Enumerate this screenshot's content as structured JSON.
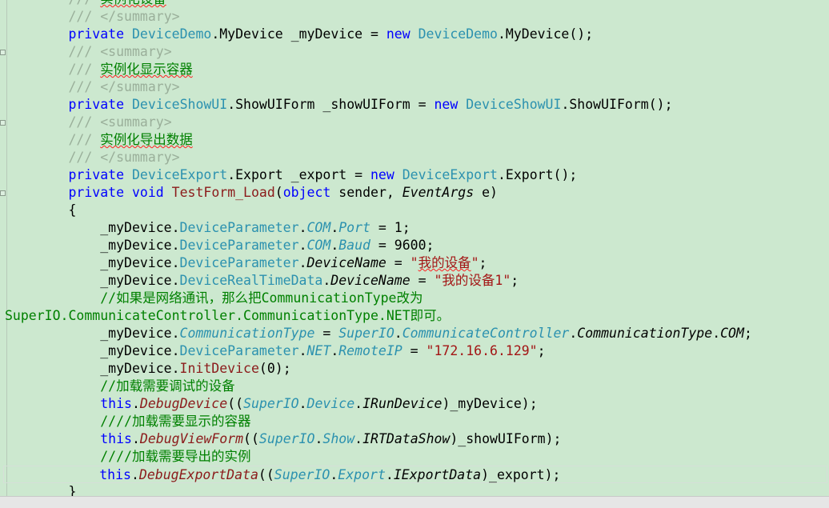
{
  "editor": {
    "lines": [
      {
        "parts": [
          {
            "t": "        "
          },
          {
            "t": "/// ",
            "c": "cg"
          },
          {
            "t": "实例化设备",
            "c": "cm sq cjk"
          }
        ]
      },
      {
        "parts": [
          {
            "t": "        "
          },
          {
            "t": "/// </summary>",
            "c": "cg"
          }
        ]
      },
      {
        "parts": [
          {
            "t": "        "
          },
          {
            "t": "private",
            "c": "kw"
          },
          {
            "t": " "
          },
          {
            "t": "DeviceDemo",
            "c": "ty"
          },
          {
            "t": ".MyDevice _myDevice = "
          },
          {
            "t": "new",
            "c": "kw"
          },
          {
            "t": " "
          },
          {
            "t": "DeviceDemo",
            "c": "ty"
          },
          {
            "t": ".MyDevice();"
          }
        ]
      },
      {
        "parts": [
          {
            "t": "        "
          },
          {
            "t": "/// <summary>",
            "c": "cg"
          }
        ]
      },
      {
        "parts": [
          {
            "t": "        "
          },
          {
            "t": "/// ",
            "c": "cg"
          },
          {
            "t": "实例化显示容器",
            "c": "cm sq cjk"
          }
        ]
      },
      {
        "parts": [
          {
            "t": "        "
          },
          {
            "t": "/// </summary>",
            "c": "cg"
          }
        ]
      },
      {
        "parts": [
          {
            "t": "        "
          },
          {
            "t": "private",
            "c": "kw"
          },
          {
            "t": " "
          },
          {
            "t": "DeviceShowUI",
            "c": "ty"
          },
          {
            "t": ".ShowUIForm _showUIForm = "
          },
          {
            "t": "new",
            "c": "kw"
          },
          {
            "t": " "
          },
          {
            "t": "DeviceShowUI",
            "c": "ty"
          },
          {
            "t": ".ShowUIForm();"
          }
        ]
      },
      {
        "parts": [
          {
            "t": "        "
          },
          {
            "t": "/// <summary>",
            "c": "cg"
          }
        ]
      },
      {
        "parts": [
          {
            "t": "        "
          },
          {
            "t": "/// ",
            "c": "cg"
          },
          {
            "t": "实例化导出数据",
            "c": "cm sq cjk"
          }
        ]
      },
      {
        "parts": [
          {
            "t": "        "
          },
          {
            "t": "/// </summary>",
            "c": "cg"
          }
        ]
      },
      {
        "parts": [
          {
            "t": "        "
          },
          {
            "t": "private",
            "c": "kw"
          },
          {
            "t": " "
          },
          {
            "t": "DeviceExport",
            "c": "ty"
          },
          {
            "t": ".Export _export = "
          },
          {
            "t": "new",
            "c": "kw"
          },
          {
            "t": " "
          },
          {
            "t": "DeviceExport",
            "c": "ty"
          },
          {
            "t": ".Export();"
          }
        ]
      },
      {
        "parts": [
          {
            "t": "        "
          },
          {
            "t": "private",
            "c": "kw"
          },
          {
            "t": " "
          },
          {
            "t": "void",
            "c": "kw"
          },
          {
            "t": " "
          },
          {
            "t": "TestForm_Load",
            "c": "fn"
          },
          {
            "t": "("
          },
          {
            "t": "object",
            "c": "kw"
          },
          {
            "t": " sender, "
          },
          {
            "t": "EventArgs",
            "c": "it"
          },
          {
            "t": " e)"
          }
        ]
      },
      {
        "parts": [
          {
            "t": "        {"
          }
        ]
      },
      {
        "parts": [
          {
            "t": "            _myDevice."
          },
          {
            "t": "DeviceParameter",
            "c": "ty"
          },
          {
            "t": "."
          },
          {
            "t": "COM",
            "c": "ti"
          },
          {
            "t": "."
          },
          {
            "t": "Port",
            "c": "ti"
          },
          {
            "t": " = 1;"
          }
        ]
      },
      {
        "parts": [
          {
            "t": "            _myDevice."
          },
          {
            "t": "DeviceParameter",
            "c": "ty"
          },
          {
            "t": "."
          },
          {
            "t": "COM",
            "c": "ti"
          },
          {
            "t": "."
          },
          {
            "t": "Baud",
            "c": "ti"
          },
          {
            "t": " = 9600;"
          }
        ]
      },
      {
        "parts": [
          {
            "t": "            _myDevice."
          },
          {
            "t": "DeviceParameter",
            "c": "ty"
          },
          {
            "t": "."
          },
          {
            "t": "DeviceName",
            "c": "it"
          },
          {
            "t": " = "
          },
          {
            "t": "\"",
            "c": "st"
          },
          {
            "t": "我的设备",
            "c": "st sq cjk"
          },
          {
            "t": "\"",
            "c": "st"
          },
          {
            "t": ";"
          }
        ]
      },
      {
        "parts": [
          {
            "t": "            _myDevice."
          },
          {
            "t": "DeviceRealTimeData",
            "c": "ty"
          },
          {
            "t": "."
          },
          {
            "t": "DeviceName",
            "c": "it"
          },
          {
            "t": " = "
          },
          {
            "t": "\"",
            "c": "st"
          },
          {
            "t": "我的设备",
            "c": "st cjk"
          },
          {
            "t": "1\"",
            "c": "st"
          },
          {
            "t": ";"
          }
        ]
      },
      {
        "parts": [
          {
            "t": "            "
          },
          {
            "t": "//如果是网络通讯，那么把CommunicationType改为",
            "c": "cm"
          }
        ]
      },
      {
        "parts": [
          {
            "t": "SuperIO.CommunicateController.CommunicationType.NET即可。",
            "c": "cm"
          }
        ]
      },
      {
        "parts": [
          {
            "t": "            _myDevice."
          },
          {
            "t": "CommunicationType",
            "c": "ti"
          },
          {
            "t": " = "
          },
          {
            "t": "SuperIO",
            "c": "ti"
          },
          {
            "t": "."
          },
          {
            "t": "CommunicateController",
            "c": "ti"
          },
          {
            "t": "."
          },
          {
            "t": "CommunicationType",
            "c": "it"
          },
          {
            "t": "."
          },
          {
            "t": "COM",
            "c": "it"
          },
          {
            "t": ";"
          }
        ]
      },
      {
        "parts": [
          {
            "t": "            _myDevice."
          },
          {
            "t": "DeviceParameter",
            "c": "ty"
          },
          {
            "t": "."
          },
          {
            "t": "NET",
            "c": "ti"
          },
          {
            "t": "."
          },
          {
            "t": "RemoteIP",
            "c": "ti"
          },
          {
            "t": " = "
          },
          {
            "t": "\"172.16.6.129\"",
            "c": "st"
          },
          {
            "t": ";"
          }
        ]
      },
      {
        "parts": [
          {
            "t": "            _myDevice."
          },
          {
            "t": "InitDevice",
            "c": "fn"
          },
          {
            "t": "(0);"
          }
        ]
      },
      {
        "parts": [
          {
            "t": "            "
          },
          {
            "t": "//加载需要调试的设备",
            "c": "cm"
          }
        ]
      },
      {
        "parts": [
          {
            "t": "            "
          },
          {
            "t": "this",
            "c": "kw"
          },
          {
            "t": "."
          },
          {
            "t": "DebugDevice",
            "c": "mt"
          },
          {
            "t": "(("
          },
          {
            "t": "SuperIO",
            "c": "ti"
          },
          {
            "t": "."
          },
          {
            "t": "Device",
            "c": "ti"
          },
          {
            "t": "."
          },
          {
            "t": "IRunDevice",
            "c": "it"
          },
          {
            "t": ")_myDevice);"
          }
        ]
      },
      {
        "parts": [
          {
            "t": "            "
          },
          {
            "t": "////加载需要显示的容器",
            "c": "cm"
          }
        ]
      },
      {
        "parts": [
          {
            "t": "            "
          },
          {
            "t": "this",
            "c": "kw"
          },
          {
            "t": "."
          },
          {
            "t": "DebugViewForm",
            "c": "mt"
          },
          {
            "t": "(("
          },
          {
            "t": "SuperIO",
            "c": "ti"
          },
          {
            "t": "."
          },
          {
            "t": "Show",
            "c": "ti"
          },
          {
            "t": "."
          },
          {
            "t": "IRTDataShow",
            "c": "it"
          },
          {
            "t": ")_showUIForm);"
          }
        ]
      },
      {
        "parts": [
          {
            "t": "            "
          },
          {
            "t": "////加载需要导出的实例",
            "c": "cm"
          }
        ]
      },
      {
        "parts": [
          {
            "t": "            "
          },
          {
            "t": "this",
            "c": "kw"
          },
          {
            "t": "."
          },
          {
            "t": "DebugExportData",
            "c": "mt"
          },
          {
            "t": "(("
          },
          {
            "t": "SuperIO",
            "c": "ti"
          },
          {
            "t": "."
          },
          {
            "t": "Export",
            "c": "ti"
          },
          {
            "t": "."
          },
          {
            "t": "IExportData",
            "c": "it"
          },
          {
            "t": ")_export);"
          }
        ]
      },
      {
        "parts": [
          {
            "t": "        }"
          }
        ]
      }
    ]
  },
  "colors": {
    "background": "#cce8cf",
    "keyword": "#0000ff",
    "type": "#2b91af",
    "comment": "#008000",
    "xml_doc_tag": "#9aaf9a",
    "string": "#a31515",
    "method": "#8b1a1a"
  }
}
